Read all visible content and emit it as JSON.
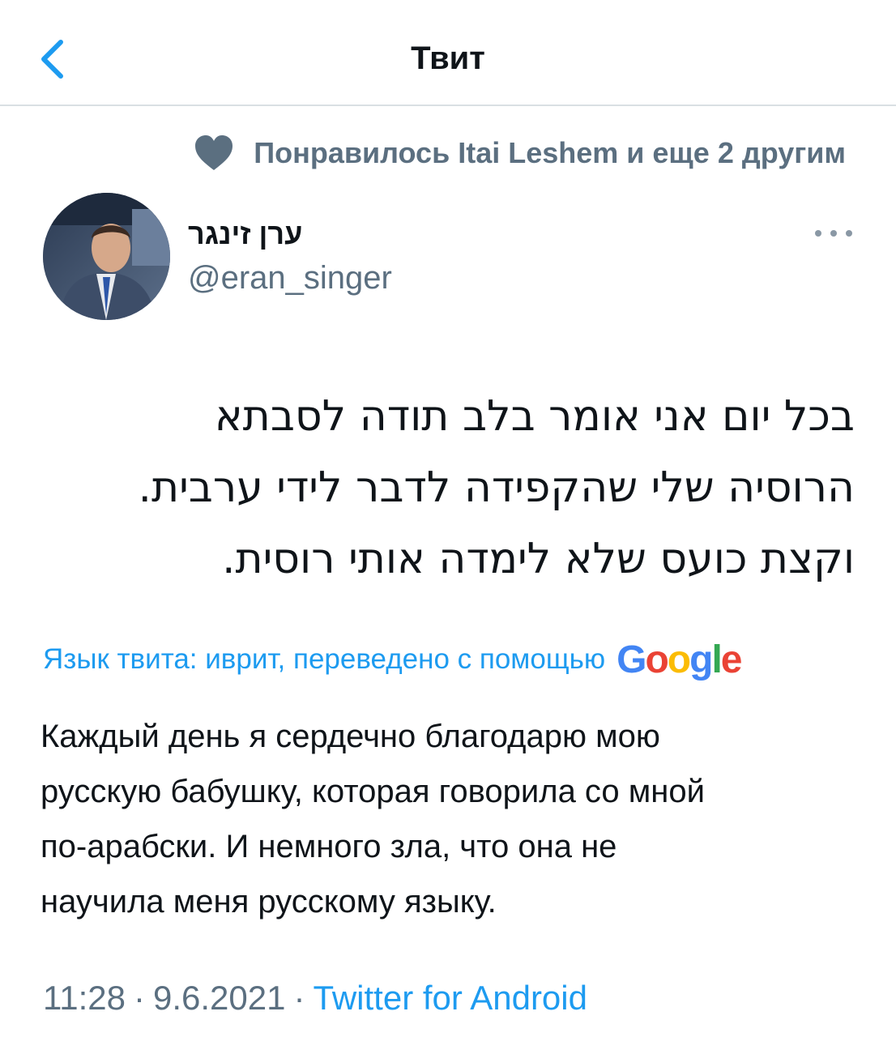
{
  "header": {
    "title": "Твит",
    "back_icon": "chevron-left-icon"
  },
  "liked_by": {
    "icon": "heart-icon",
    "text": "Понравилось Itai Leshem и еще 2 другим"
  },
  "author": {
    "name": "ערן זינגר",
    "handle": "@eran_singer"
  },
  "tweet": {
    "original_lines": [
      "בכל יום אני אומר בלב תודה לסבתא",
      "הרוסיה שלי שהקפידה לדבר לידי ערבית.",
      "וקצת כועס שלא לימדה אותי רוסית."
    ],
    "translation_label": "Язык твита: иврит, переведено с помощью",
    "translation_provider": "Google",
    "translation_lines": [
      "Каждый день я сердечно благодарю мою",
      "русскую бабушку, которая говорила со мной",
      "по-арабски. И немного зла, что она не",
      "научила меня русскому языку."
    ]
  },
  "meta": {
    "time": "11:28",
    "separator": "·",
    "date": "9.6.2021",
    "source": "Twitter for Android"
  },
  "colors": {
    "accent": "#1d9bf0",
    "secondary_text": "#5b6f80",
    "divider": "#d9dfe3"
  }
}
